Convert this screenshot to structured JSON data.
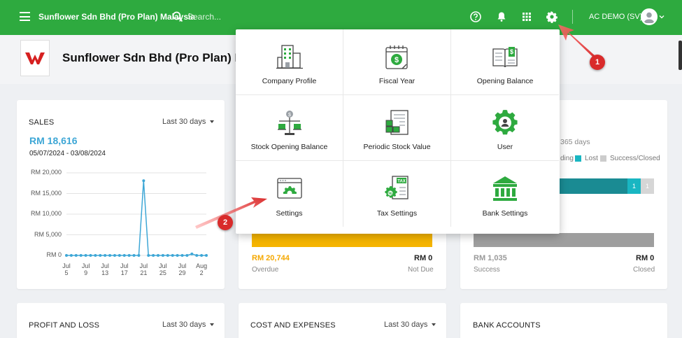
{
  "topbar": {
    "company": "Sunflower Sdn Bhd (Pro Plan) Malaysia",
    "search_placeholder": "Search...",
    "user": "AC DEMO (SV)",
    "icons": [
      "help-icon",
      "bell-icon",
      "apps-grid-icon",
      "gear-icon"
    ]
  },
  "header": {
    "title": "Sunflower Sdn Bhd (Pro Plan) Mal"
  },
  "sales": {
    "title": "SALES",
    "period": "Last 30 days",
    "amount": "RM 18,616",
    "range": "05/07/2024 - 03/08/2024",
    "chart_data": {
      "type": "line",
      "y_ticks": [
        "RM 20,000",
        "RM 15,000",
        "RM 10,000",
        "RM 5,000",
        "RM 0"
      ],
      "ylim": [
        0,
        20000
      ],
      "x_ticks": [
        [
          "Jul",
          "5"
        ],
        [
          "Jul",
          "9"
        ],
        [
          "Jul",
          "13"
        ],
        [
          "Jul",
          "17"
        ],
        [
          "Jul",
          "21"
        ],
        [
          "Jul",
          "25"
        ],
        [
          "Jul",
          "29"
        ],
        [
          "Aug",
          "2"
        ]
      ],
      "series": [
        {
          "values": [
            0,
            0,
            0,
            0,
            0,
            0,
            0,
            0,
            0,
            0,
            0,
            0,
            0,
            0,
            0,
            0,
            18100,
            0,
            0,
            0,
            0,
            0,
            0,
            0,
            0,
            0,
            350,
            0,
            0,
            0
          ]
        }
      ],
      "color": "#3ea7d6"
    }
  },
  "invoices": {
    "overdue_amount": "RM 20,744",
    "overdue_label": "Overdue",
    "notdue_amount": "RM 0",
    "notdue_label": "Not Due"
  },
  "opportunities": {
    "days_text": "365 days",
    "legend": [
      {
        "label": "ding",
        "color": ""
      },
      {
        "label": "Lost",
        "color": "#19b6c2"
      },
      {
        "label": "Success/Closed",
        "color": "#cccccc"
      }
    ],
    "seg1": "1",
    "seg2": "1",
    "success_amount": "RM 1,035",
    "success_label": "Success",
    "closed_amount": "RM 0",
    "closed_label": "Closed"
  },
  "bottom": {
    "profit_title": "PROFIT AND LOSS",
    "profit_period": "Last 30 days",
    "cost_title": "COST AND EXPENSES",
    "cost_period": "Last 30 days",
    "bank_title": "BANK ACCOUNTS"
  },
  "menu": {
    "items": [
      {
        "label": "Company Profile",
        "icon": "building-icon"
      },
      {
        "label": "Fiscal Year",
        "icon": "calendar-dollar-icon"
      },
      {
        "label": "Opening Balance",
        "icon": "ledger-book-icon"
      },
      {
        "label": "Stock Opening Balance",
        "icon": "scale-boxes-icon"
      },
      {
        "label": "Periodic Stock Value",
        "icon": "stock-report-icon"
      },
      {
        "label": "User",
        "icon": "user-gear-icon"
      },
      {
        "label": "Settings",
        "icon": "settings-window-icon"
      },
      {
        "label": "Tax Settings",
        "icon": "tax-document-icon"
      },
      {
        "label": "Bank Settings",
        "icon": "bank-icon"
      }
    ]
  },
  "annotations": {
    "marker1": "1",
    "marker2": "2",
    "color": "#d92b2b"
  }
}
